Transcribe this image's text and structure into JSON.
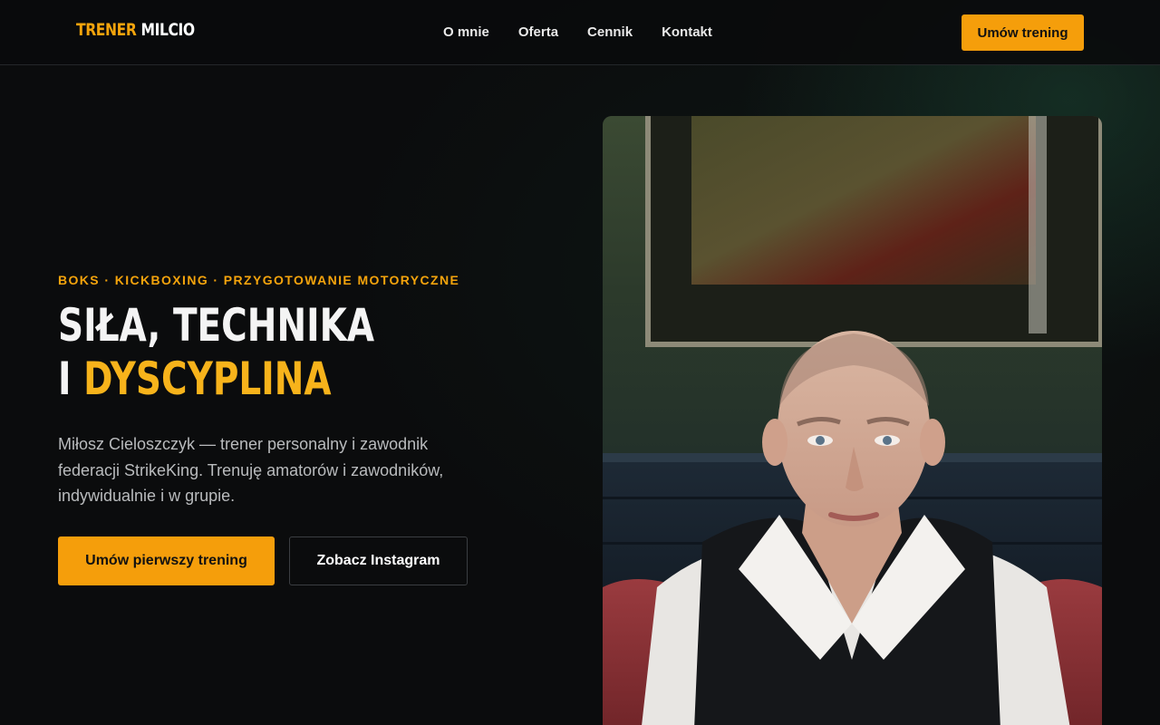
{
  "header": {
    "logo": {
      "part1": "TRENER",
      "part2": "MILCIO"
    },
    "nav": [
      "O mnie",
      "Oferta",
      "Cennik",
      "Kontakt"
    ],
    "cta_label": "Umów trening"
  },
  "hero": {
    "eyebrow": "BOKS · KICKBOXING · PRZYGOTOWANIE MOTORYCZNE",
    "headline_line1": "SIŁA, TECHNIKA",
    "headline_line2_prefix": "I",
    "headline_line2_accent": "DYSCYPLINA",
    "lead": "Miłosz Cieloszczyk — trener personalny i zawodnik federacji StrikeKing. Trenuję amatorów i zawodników, indywidualnie i w grupie.",
    "primary_button": "Umów pierwszy trening",
    "secondary_button": "Zobacz Instagram"
  },
  "colors": {
    "accent": "#f59e0b",
    "background": "#0b0c0d",
    "text": "#f2f2f2",
    "muted_text": "#b9bbbd"
  },
  "icons": {
    "hero_photo": "trainer-portrait-photo"
  }
}
